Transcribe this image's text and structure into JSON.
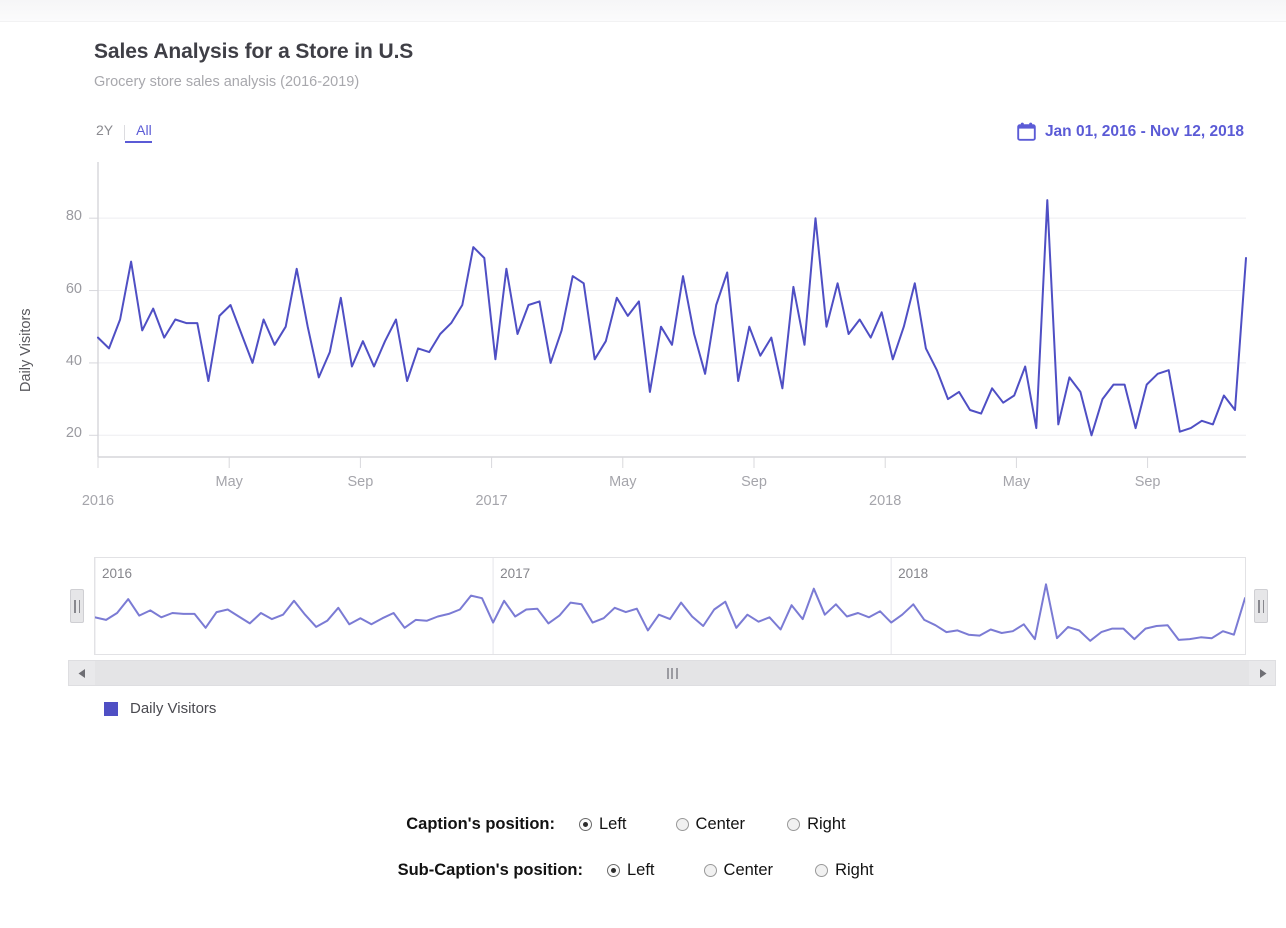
{
  "header": {
    "title": "Sales Analysis for a Store in U.S",
    "subtitle": "Grocery store sales analysis (2016-2019)"
  },
  "range_selector": {
    "options": [
      {
        "label": "2Y",
        "active": false
      },
      {
        "label": "All",
        "active": true
      }
    ],
    "date_range_label": "Jan 01, 2016 - Nov 12, 2018",
    "calendar_icon": "calendar-icon",
    "accent_color": "#5b5bd6"
  },
  "legend": {
    "label": "Daily Visitors",
    "color": "#4f4fc4"
  },
  "navigator": {
    "year_labels": [
      "2016",
      "2017",
      "2018"
    ],
    "left_arrow_icon": "arrow-left-icon",
    "right_arrow_icon": "arrow-right-icon",
    "handle_icon": "drag-handle-icon",
    "line_color": "#7b7bd4"
  },
  "controls": {
    "rows": [
      {
        "label": "Caption's position:",
        "name": "caption-position",
        "options": [
          {
            "label": "Left",
            "checked": true
          },
          {
            "label": "Center",
            "checked": false
          },
          {
            "label": "Right",
            "checked": false
          }
        ]
      },
      {
        "label": "Sub-Caption's position:",
        "name": "subcaption-position",
        "options": [
          {
            "label": "Left",
            "checked": true
          },
          {
            "label": "Center",
            "checked": false
          },
          {
            "label": "Right",
            "checked": false
          }
        ]
      }
    ]
  },
  "chart_data": {
    "type": "line",
    "title": "Sales Analysis for a Store in U.S",
    "subtitle": "Grocery store sales analysis (2016-2019)",
    "xlabel": "",
    "ylabel": "Daily Visitors",
    "ylim": [
      14,
      90
    ],
    "yticks": [
      20,
      40,
      60,
      80
    ],
    "grid": true,
    "legend_position": "bottom-left",
    "line_color": "#4f4fc4",
    "x_tick_labels": [
      "2016",
      "May",
      "Sep",
      "2017",
      "May",
      "Sep",
      "2018",
      "May",
      "Sep"
    ],
    "x_tick_positions": [
      0,
      12,
      24,
      36,
      48,
      60,
      72,
      84,
      96
    ],
    "x_range": [
      0,
      105
    ],
    "series": [
      {
        "name": "Daily Visitors",
        "values": [
          47,
          44,
          52,
          68,
          49,
          55,
          47,
          52,
          51,
          51,
          35,
          53,
          56,
          48,
          40,
          52,
          45,
          50,
          66,
          50,
          36,
          43,
          58,
          39,
          46,
          39,
          46,
          52,
          35,
          44,
          43,
          48,
          51,
          56,
          72,
          69,
          41,
          66,
          48,
          56,
          57,
          40,
          49,
          64,
          62,
          41,
          46,
          58,
          53,
          57,
          32,
          50,
          45,
          64,
          48,
          37,
          56,
          65,
          35,
          50,
          42,
          47,
          33,
          61,
          45,
          80,
          50,
          62,
          48,
          52,
          47,
          54,
          41,
          50,
          62,
          44,
          38,
          30,
          32,
          27,
          26,
          33,
          29,
          31,
          39,
          22,
          85,
          23,
          36,
          32,
          20,
          30,
          34,
          34,
          22,
          34,
          37,
          38,
          21,
          22,
          24,
          23,
          31,
          27,
          69
        ]
      }
    ]
  }
}
